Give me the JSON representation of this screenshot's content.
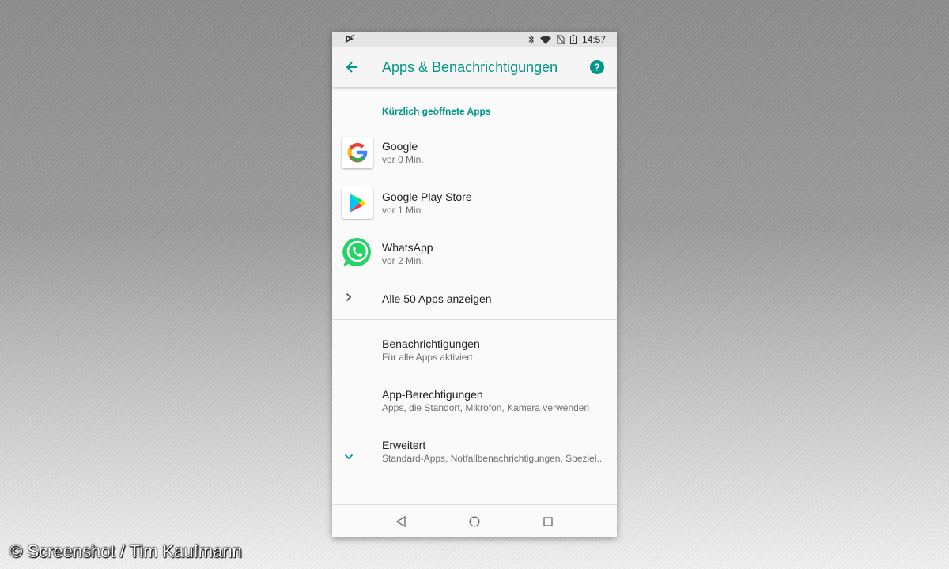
{
  "status_bar": {
    "time": "14:57"
  },
  "app_bar": {
    "title": "Apps & Benachrichtigungen"
  },
  "recent": {
    "header": "Kürzlich geöffnete Apps",
    "apps": [
      {
        "name": "Google",
        "time": "vor 0 Min.",
        "icon": "google-icon"
      },
      {
        "name": "Google Play Store",
        "time": "vor 1 Min.",
        "icon": "play-store-icon"
      },
      {
        "name": "WhatsApp",
        "time": "vor 2 Min.",
        "icon": "whatsapp-icon"
      }
    ],
    "show_all": "Alle 50 Apps anzeigen"
  },
  "settings": [
    {
      "title": "Benachrichtigungen",
      "subtitle": "Für alle Apps aktiviert"
    },
    {
      "title": "App-Berechtigungen",
      "subtitle": "Apps, die Standort, Mikrofon, Kamera verwenden"
    },
    {
      "title": "Erweitert",
      "subtitle": "Standard-Apps, Notfallbenachrichtigungen, Speziel.."
    }
  ],
  "colors": {
    "accent": "#009688",
    "whatsapp": "#25d366"
  },
  "watermark": "© Screenshot / Tim Kaufmann"
}
